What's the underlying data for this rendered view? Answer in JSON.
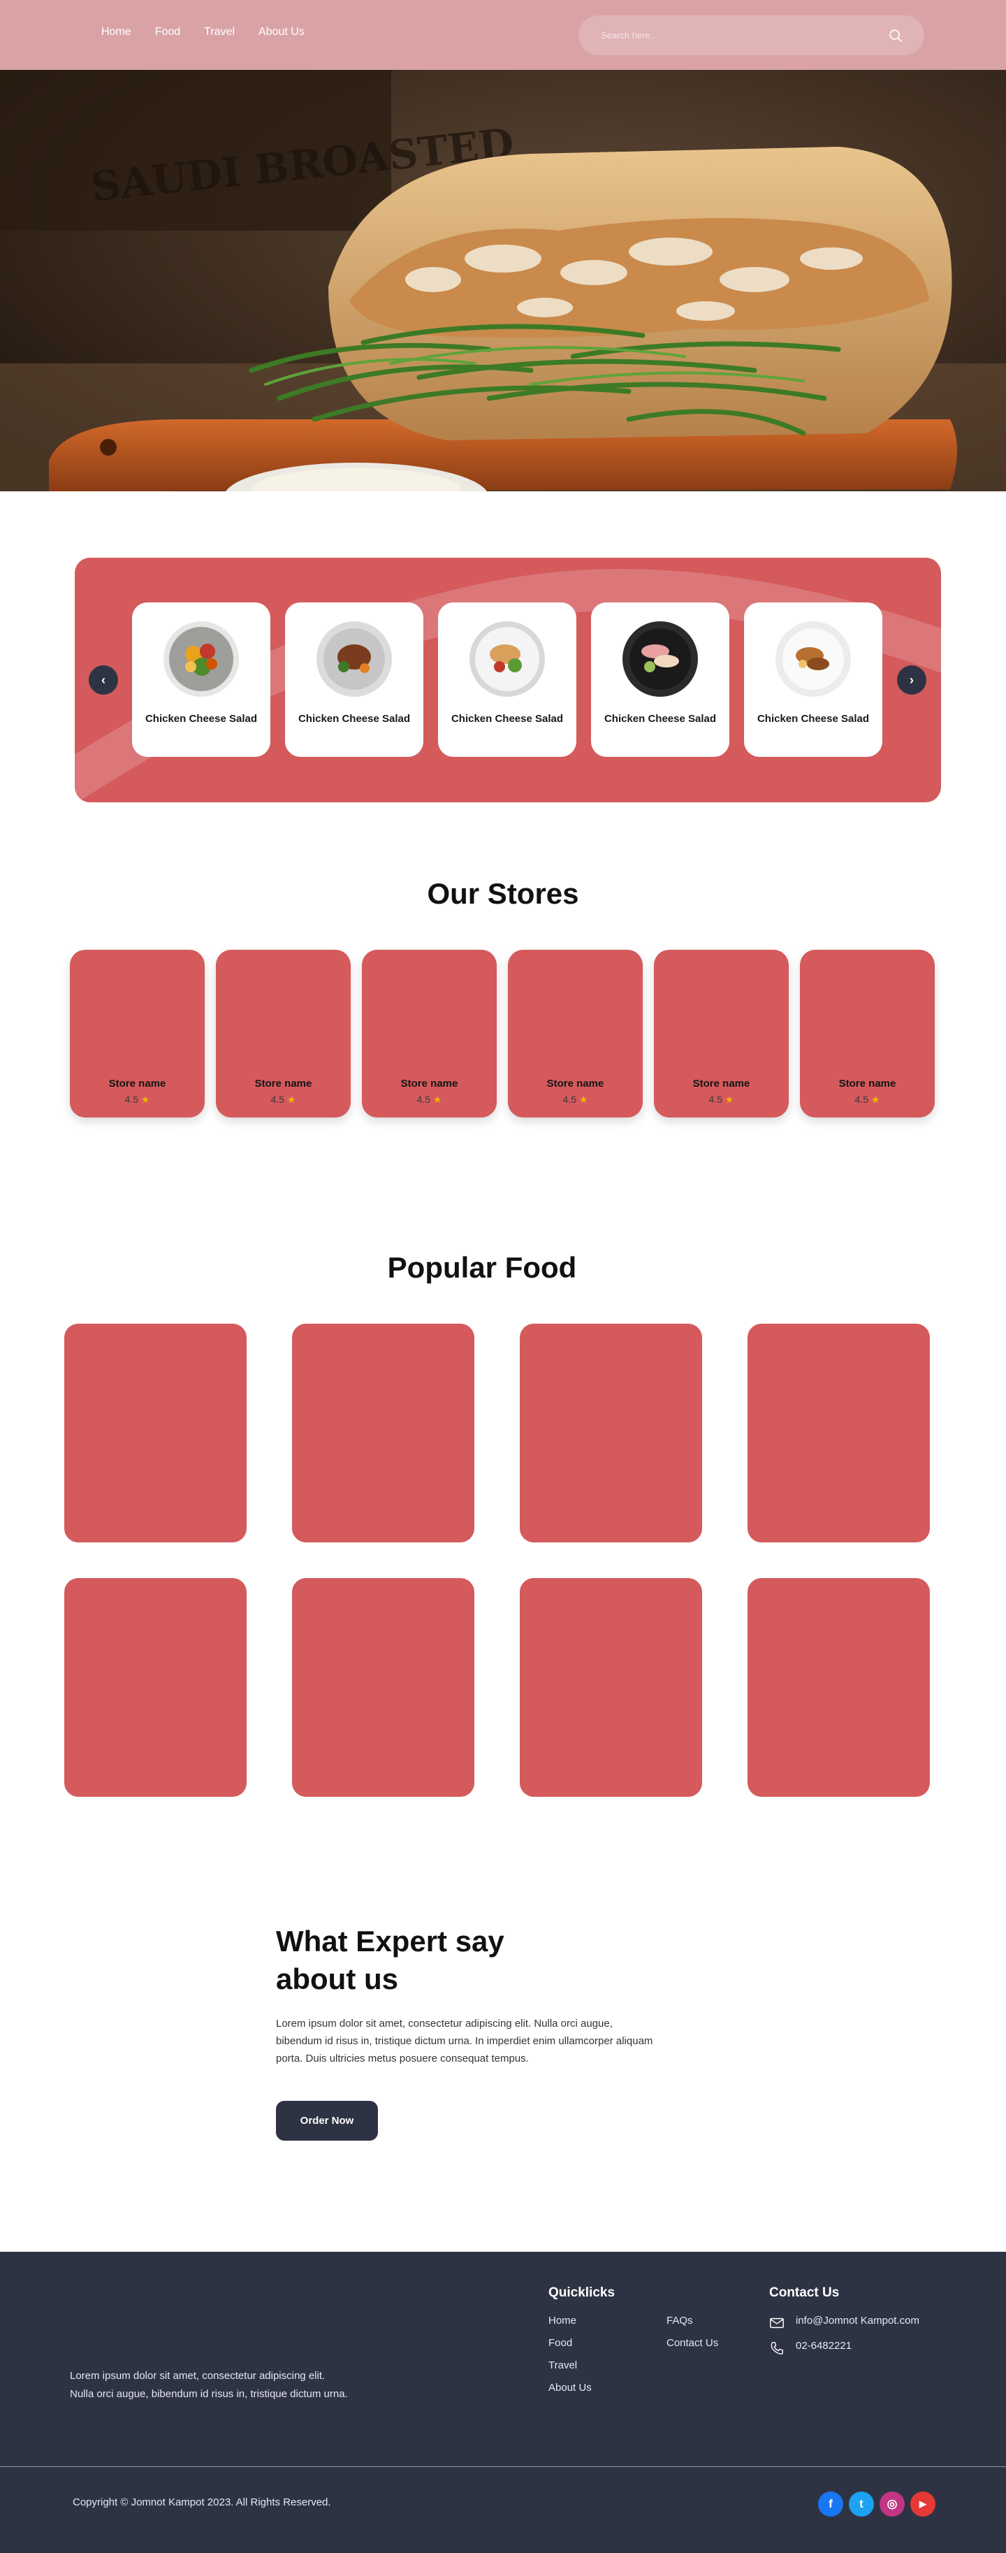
{
  "nav": {
    "links": [
      "Home",
      "Food",
      "Travel",
      "About Us"
    ],
    "search_placeholder": "Search here..",
    "bg_color": "#d9a3a6"
  },
  "hero": {
    "image": "sandwich-hero-photo",
    "sign_text": "SAUDI BROASTED"
  },
  "categories": {
    "prev_icon": "chevron-left-icon",
    "next_icon": "chevron-right-icon",
    "items": [
      {
        "label": "Chicken Cheese Salad",
        "icon": "salad-plate-icon"
      },
      {
        "label": "Chicken Cheese Salad",
        "icon": "steak-plate-icon"
      },
      {
        "label": "Chicken Cheese Salad",
        "icon": "chicken-plate-icon"
      },
      {
        "label": "Chicken Cheese Salad",
        "icon": "cold-cuts-plate-icon"
      },
      {
        "label": "Chicken Cheese Salad",
        "icon": "grilled-plate-icon"
      }
    ],
    "accent_color": "#d45a5c"
  },
  "stores": {
    "title": "Our Stores",
    "items": [
      {
        "name": "Store name",
        "rating": "4.5"
      },
      {
        "name": "Store name",
        "rating": "4.5"
      },
      {
        "name": "Store name",
        "rating": "4.5"
      },
      {
        "name": "Store name",
        "rating": "4.5"
      },
      {
        "name": "Store name",
        "rating": "4.5"
      },
      {
        "name": "Store name",
        "rating": "4.5"
      }
    ],
    "star": "★"
  },
  "popular": {
    "title": "Popular Food",
    "count": 8
  },
  "expert": {
    "title": "What Expert say about us",
    "text": "Lorem ipsum dolor sit amet, consectetur adipiscing elit. Nulla orci augue, bibendum id risus in, tristique dictum urna. In imperdiet enim ullamcorper aliquam porta. Duis ultricies metus posuere consequat tempus.",
    "button": "Order Now"
  },
  "footer": {
    "about": "Lorem ipsum dolor sit amet, consectetur adipiscing elit. Nulla orci augue, bibendum id risus in, tristique dictum urna.",
    "quicklinks_title": "Quicklicks",
    "quicklinks_col1": [
      "Home",
      "Food",
      "Travel",
      "About Us"
    ],
    "quicklinks_col2": [
      "FAQs",
      "Contact Us"
    ],
    "contact_title": "Contact Us",
    "email": "info@Jomnot Kampot.com",
    "phone": "02-6482221",
    "copyright": "Copyright © Jomnot Kampot 2023. All Rights Reserved.",
    "social": [
      {
        "name": "facebook-icon",
        "glyph": "f",
        "color": "#1877f2"
      },
      {
        "name": "twitter-icon",
        "glyph": "t",
        "color": "#1da1f2"
      },
      {
        "name": "instagram-icon",
        "glyph": "◎",
        "color": "#c13584"
      },
      {
        "name": "youtube-icon",
        "glyph": "▶",
        "color": "#e53935"
      }
    ],
    "bg_color": "#2e3344"
  }
}
